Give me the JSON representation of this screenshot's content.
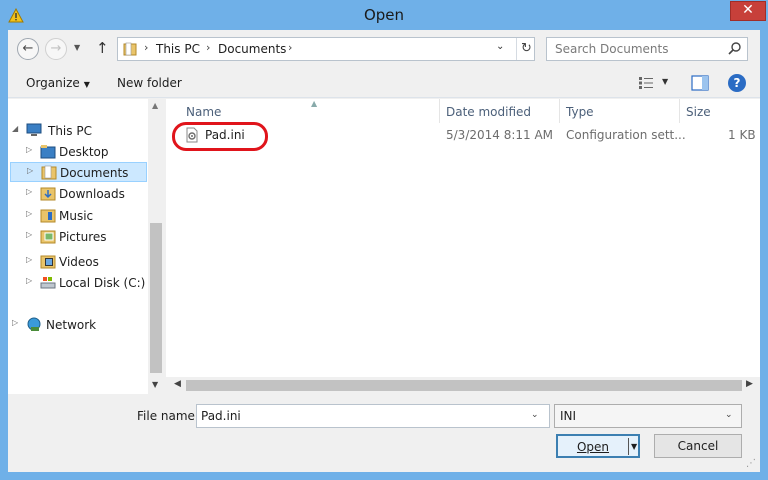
{
  "window": {
    "title": "Open",
    "close_label": "✕"
  },
  "nav": {
    "back_glyph": "←",
    "forward_glyph": "→",
    "recent_glyph": "▼",
    "up_glyph": "↑"
  },
  "address": {
    "crumbs": [
      "This PC",
      "Documents"
    ],
    "sep": "›",
    "dropdown_glyph": "⌄",
    "refresh_glyph": "↻"
  },
  "search": {
    "placeholder": "Search Documents"
  },
  "commands": {
    "organize": "Organize",
    "new_folder": "New folder",
    "help": "?"
  },
  "tree": [
    {
      "label": "This PC",
      "icon": "pc-icon"
    },
    {
      "label": "Desktop",
      "icon": "folder-icon"
    },
    {
      "label": "Documents",
      "icon": "folder-icon",
      "selected": true
    },
    {
      "label": "Downloads",
      "icon": "folder-icon"
    },
    {
      "label": "Music",
      "icon": "folder-icon"
    },
    {
      "label": "Pictures",
      "icon": "folder-icon"
    },
    {
      "label": "Videos",
      "icon": "folder-icon"
    },
    {
      "label": "Local Disk (C:)",
      "icon": "drive-icon"
    },
    {
      "label": "Network",
      "icon": "network-icon"
    }
  ],
  "columns": {
    "name": "Name",
    "date": "Date modified",
    "type": "Type",
    "size": "Size"
  },
  "files": [
    {
      "name": "Pad.ini",
      "date": "5/3/2014 8:11 AM",
      "type": "Configuration sett...",
      "size": "1 KB"
    }
  ],
  "bottom": {
    "filename_label": "File name:",
    "filename_value": "Pad.ini",
    "filter_value": "INI",
    "open_label": "Open",
    "cancel_label": "Cancel"
  },
  "colors": {
    "accent": "#6fb0e8",
    "selection": "#cce8ff",
    "highlight_ring": "#e0141b"
  }
}
